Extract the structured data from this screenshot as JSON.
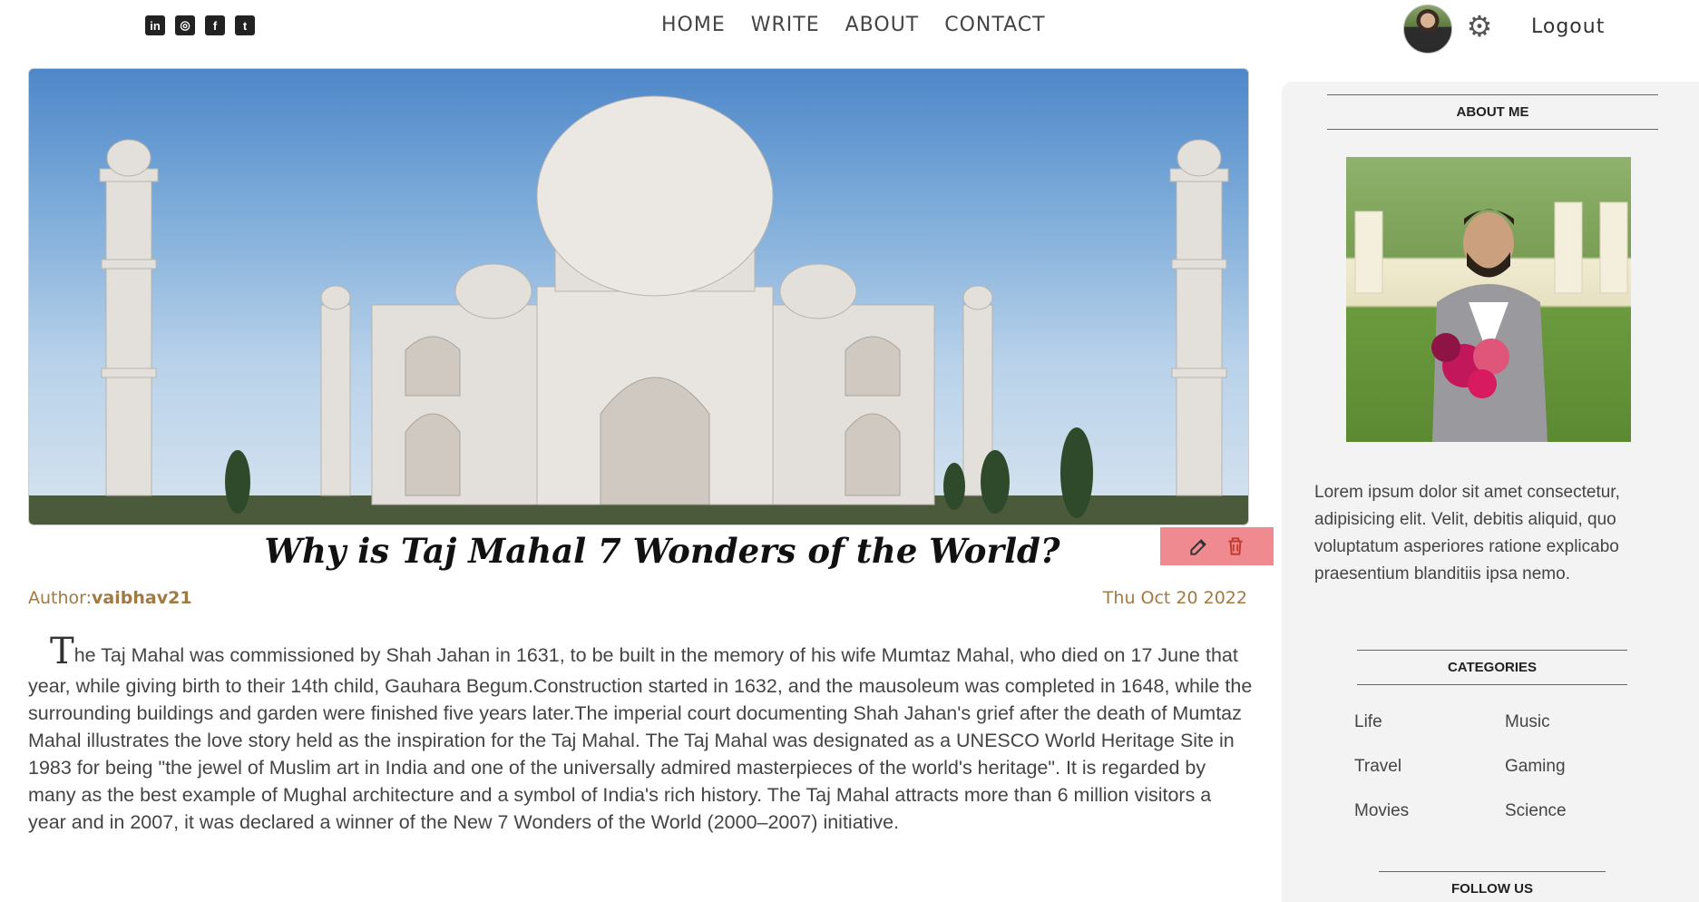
{
  "social": {
    "linkedin": "in",
    "instagram": "◎",
    "facebook": "f",
    "twitter": "t"
  },
  "nav": [
    "HOME",
    "WRITE",
    "ABOUT",
    "CONTACT"
  ],
  "header": {
    "logout_label": "Logout"
  },
  "post": {
    "title": "Why is Taj Mahal 7 Wonders of the World?",
    "author_prefix": "Author:",
    "author": "vaibhav21",
    "date": "Thu Oct 20 2022",
    "drop_cap": "T",
    "body": "he Taj Mahal was commissioned by Shah Jahan in 1631, to be built in the memory of his wife Mumtaz Mahal, who died on 17 June that year, while giving birth to their 14th child, Gauhara Begum.Construction started in 1632, and the mausoleum was completed in 1648, while the surrounding buildings and garden were finished five years later.The imperial court documenting Shah Jahan's grief after the death of Mumtaz Mahal illustrates the love story held as the inspiration for the Taj Mahal. The Taj Mahal was designated as a UNESCO World Heritage Site in 1983 for being \"the jewel of Muslim art in India and one of the universally admired masterpieces of the world's heritage\". It is regarded by many as the best example of Mughal architecture and a symbol of India's rich history. The Taj Mahal attracts more than 6 million visitors a year and in 2007, it was declared a winner of the New 7 Wonders of the World (2000–2007) initiative."
  },
  "sidebar": {
    "about_title": "ABOUT ME",
    "about_text": "Lorem ipsum dolor sit amet consectetur, adipisicing elit. Velit, debitis aliquid, quo voluptatum asperiores ratione explicabo praesentium blanditiis ipsa nemo.",
    "categories_title": "CATEGORIES",
    "categories": [
      "Life",
      "Music",
      "Travel",
      "Gaming",
      "Movies",
      "Science"
    ],
    "follow_title": "FOLLOW US"
  },
  "colors": {
    "accent": "#a07a43",
    "edit_bg": "#ee8a90",
    "sidebar_bg": "#f3f3f3"
  },
  "icons": [
    "linkedin-icon",
    "instagram-icon",
    "facebook-icon",
    "twitter-icon",
    "gear-icon",
    "edit-icon",
    "trash-icon"
  ]
}
